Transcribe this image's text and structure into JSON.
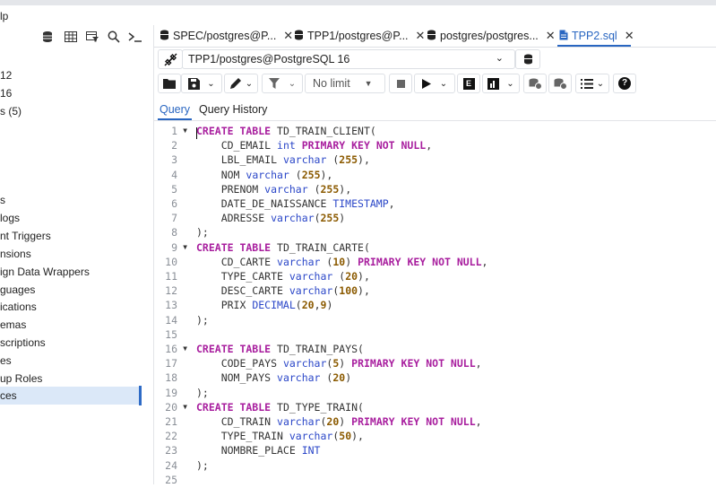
{
  "menu": {
    "help_fragment": "lp"
  },
  "left_panel": {
    "toolbar_icons": [
      "database-icon",
      "table-icon",
      "filter-table-icon",
      "search-icon",
      "terminal-icon"
    ],
    "tree_items": [
      "12",
      "16",
      "s (5)",
      "s",
      "logs",
      "nt Triggers",
      "nsions",
      "ign Data Wrappers",
      "guages",
      "ications",
      "emas",
      "scriptions",
      "es",
      "up Roles",
      "ces"
    ],
    "selected_index": 14
  },
  "tabs": [
    {
      "label": "SPEC/postgres@P...",
      "icon": "database-icon",
      "active": false
    },
    {
      "label": "TPP1/postgres@P...",
      "icon": "database-icon",
      "active": false
    },
    {
      "label": "postgres/postgres...",
      "icon": "database-icon",
      "active": false
    },
    {
      "label": "TPP2.sql",
      "icon": "file-icon",
      "active": true
    }
  ],
  "connection": {
    "value": "TPP1/postgres@PostgreSQL 16"
  },
  "toolbar": {
    "limit_label": "No limit"
  },
  "query_tabs": [
    {
      "label": "Query",
      "active": true
    },
    {
      "label": "Query History",
      "active": false
    }
  ],
  "editor": {
    "lines": [
      "CREATE TABLE TD_TRAIN_CLIENT(",
      "    CD_EMAIL int PRIMARY KEY NOT NULL,",
      "    LBL_EMAIL varchar (255),",
      "    NOM varchar (255),",
      "    PRENOM varchar (255),",
      "    DATE_DE_NAISSANCE TIMESTAMP,",
      "    ADRESSE varchar(255)",
      ");",
      "CREATE TABLE TD_TRAIN_CARTE(",
      "    CD_CARTE varchar (10) PRIMARY KEY NOT NULL,",
      "    TYPE_CARTE varchar (20),",
      "    DESC_CARTE varchar(100),",
      "    PRIX DECIMAL(20,9)",
      ");",
      "",
      "CREATE TABLE TD_TRAIN_PAYS(",
      "    CODE_PAYS varchar(5) PRIMARY KEY NOT NULL,",
      "    NOM_PAYS varchar (20)",
      ");",
      "CREATE TABLE TD_TYPE_TRAIN(",
      "    CD_TRAIN varchar(20) PRIMARY KEY NOT NULL,",
      "    TYPE_TRAIN varchar(50),",
      "    NOMBRE_PLACE INT",
      ");",
      ""
    ],
    "fold_lines": [
      1,
      9,
      16,
      20
    ]
  }
}
